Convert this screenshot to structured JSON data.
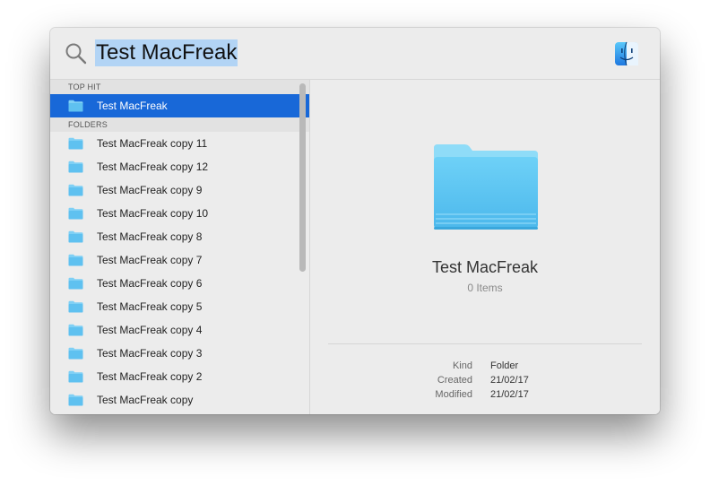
{
  "search": {
    "query": "Test MacFreak"
  },
  "icons": {
    "search": "magnifier-icon",
    "finder": "finder-icon",
    "folder": "folder-icon"
  },
  "colors": {
    "selection": "#1868d8",
    "query_highlight": "#b2d4f5",
    "folder": "#5fc1f0"
  },
  "sidebar": {
    "top_hit_header": "TOP HIT",
    "top_hit": {
      "label": "Test MacFreak"
    },
    "folders_header": "FOLDERS",
    "folders": [
      {
        "label": "Test MacFreak copy 11"
      },
      {
        "label": "Test MacFreak copy 12"
      },
      {
        "label": "Test MacFreak copy 9"
      },
      {
        "label": "Test MacFreak copy 10"
      },
      {
        "label": "Test MacFreak copy 8"
      },
      {
        "label": "Test MacFreak copy 7"
      },
      {
        "label": "Test MacFreak copy 6"
      },
      {
        "label": "Test MacFreak copy 5"
      },
      {
        "label": "Test MacFreak copy 4"
      },
      {
        "label": "Test MacFreak copy 3"
      },
      {
        "label": "Test MacFreak copy 2"
      },
      {
        "label": "Test MacFreak copy"
      }
    ]
  },
  "preview": {
    "title": "Test MacFreak",
    "subtitle": "0 Items",
    "meta": [
      {
        "key": "Kind",
        "value": "Folder"
      },
      {
        "key": "Created",
        "value": "21/02/17"
      },
      {
        "key": "Modified",
        "value": "21/02/17"
      }
    ]
  }
}
